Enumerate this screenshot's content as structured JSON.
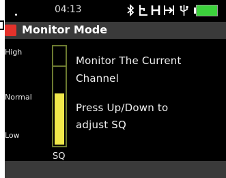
{
  "status": {
    "time": "04:13",
    "icons": [
      "bluetooth-icon",
      "signal-step-icon",
      "h-icon",
      "skip-to-end-icon",
      "usb-icon",
      "battery-icon"
    ],
    "battery_color": "#3cd23c"
  },
  "header": {
    "title": "Monitor Mode",
    "indicator_color": "#e4322b"
  },
  "meter": {
    "label": "SQ",
    "level_labels": {
      "high": "High",
      "normal": "Normal",
      "low": "Low"
    },
    "level_fraction": 0.53,
    "fill_color": "#f0e84a"
  },
  "message": {
    "line1": "Monitor The Current",
    "line2": "Channel",
    "line3": "Press Up/Down to",
    "line4": "adjust SQ"
  }
}
